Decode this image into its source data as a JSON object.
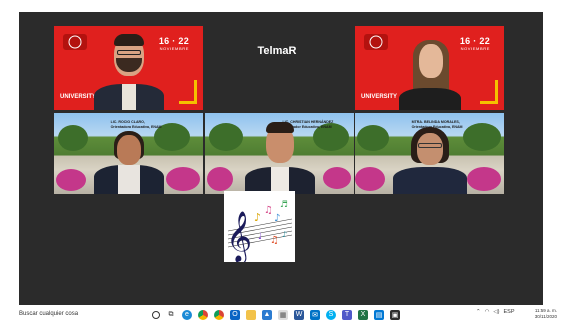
{
  "meeting": {
    "center_label": "TelmaR",
    "brand_dates": "16 · 22",
    "brand_month": "NOVIEMBRE",
    "brand_university": "UNIVERSITY",
    "captions": {
      "left": [
        "LIC. ROCIO CLARO,",
        "Orientadora Educativa, ENAM"
      ],
      "middle": [
        "LIC. CHRISTIAN HERNÁNDEZ",
        "Orientador Educativo, ENAM"
      ],
      "right": [
        "MTRA. BELINDA MORALES,",
        "Orientadora Educativa, ENAM"
      ]
    }
  },
  "taskbar": {
    "search_placeholder": "Buscar cualquier cosa",
    "language": "ESP",
    "time": "11:59 a. m.",
    "date": "30/11/2020"
  },
  "colors": {
    "brand_red": "#e0201e",
    "active_speaker": "#e8e46a",
    "meeting_bg": "#2b2b2b"
  }
}
